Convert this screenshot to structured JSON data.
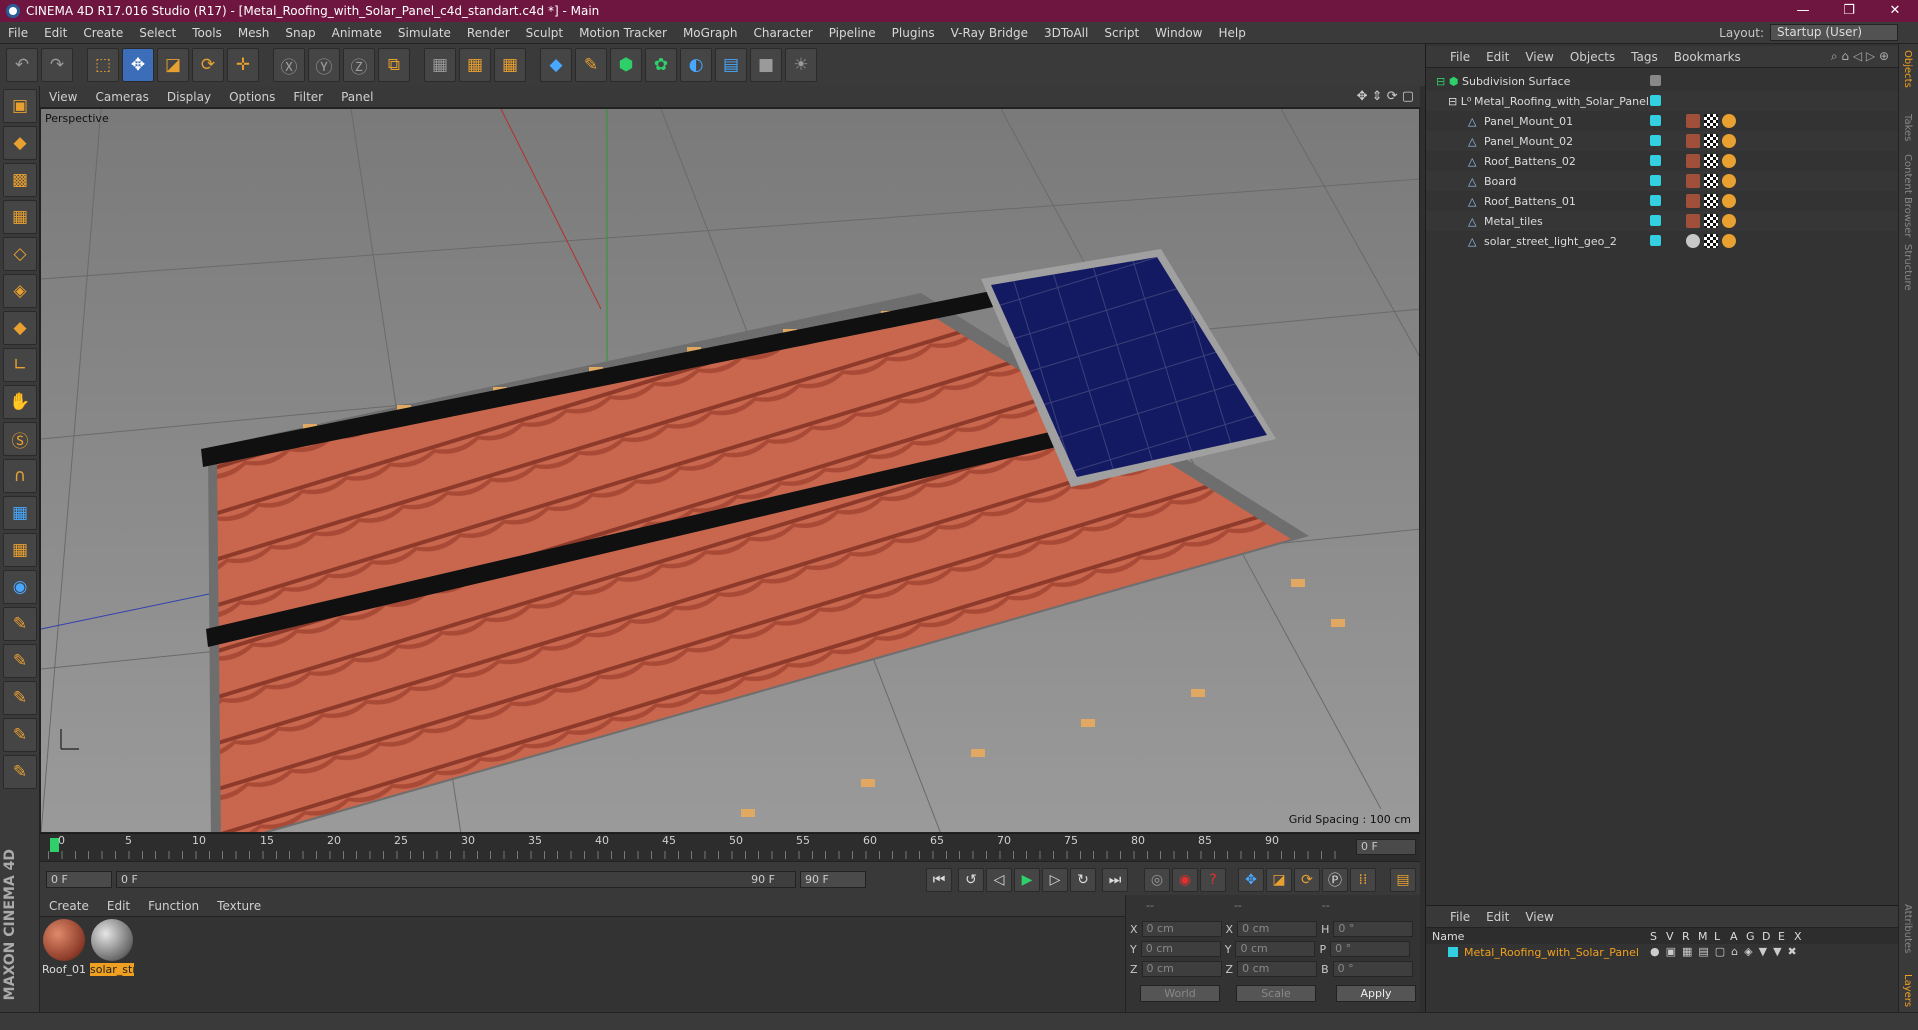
{
  "app": {
    "title": "CINEMA 4D R17.016 Studio (R17) - [Metal_Roofing_with_Solar_Panel_c4d_standart.c4d *] - Main",
    "window_buttons": [
      "—",
      "❐",
      "✕"
    ]
  },
  "menu": [
    "File",
    "Edit",
    "Create",
    "Select",
    "Tools",
    "Mesh",
    "Snap",
    "Animate",
    "Simulate",
    "Render",
    "Sculpt",
    "Motion Tracker",
    "MoGraph",
    "Character",
    "Pipeline",
    "Plugins",
    "V-Ray Bridge",
    "3DToAll",
    "Script",
    "Window",
    "Help"
  ],
  "layout": {
    "label": "Layout:",
    "value": "Startup (User)"
  },
  "viewport": {
    "menu": [
      "View",
      "Cameras",
      "Display",
      "Options",
      "Filter",
      "Panel"
    ],
    "label": "Perspective",
    "grid_spacing": "Grid Spacing : 100 cm"
  },
  "timeline": {
    "ticks": [
      "0",
      "5",
      "10",
      "15",
      "20",
      "25",
      "30",
      "35",
      "40",
      "45",
      "50",
      "55",
      "60",
      "65",
      "70",
      "75",
      "80",
      "85",
      "90"
    ],
    "current_frame": "0 F"
  },
  "transport": {
    "start": "0 F",
    "range_start": "0 F",
    "range_end": "90 F",
    "end": "90 F"
  },
  "materials": {
    "menu": [
      "Create",
      "Edit",
      "Function",
      "Texture"
    ],
    "items": [
      {
        "name": "Roof_01",
        "selected": false
      },
      {
        "name": "solar_str",
        "selected": true
      }
    ]
  },
  "coordinates": {
    "headers": [
      "--",
      "--",
      "--"
    ],
    "rows": [
      {
        "a": "X",
        "av": "0 cm",
        "b": "X",
        "bv": "0 cm",
        "c": "H",
        "cv": "0 °"
      },
      {
        "a": "Y",
        "av": "0 cm",
        "b": "Y",
        "bv": "0 cm",
        "c": "P",
        "cv": "0 °"
      },
      {
        "a": "Z",
        "av": "0 cm",
        "b": "Z",
        "bv": "0 cm",
        "c": "B",
        "cv": "0 °"
      }
    ],
    "mode": "World",
    "scale": "Scale",
    "apply": "Apply"
  },
  "objects": {
    "menu": [
      "File",
      "Edit",
      "View",
      "Objects",
      "Tags",
      "Bookmarks"
    ],
    "items": [
      {
        "name": "Subdivision Surface",
        "level": 0
      },
      {
        "name": "Metal_Roofing_with_Solar_Panel",
        "level": 1
      },
      {
        "name": "Panel_Mount_01",
        "level": 2
      },
      {
        "name": "Panel_Mount_02",
        "level": 2
      },
      {
        "name": "Roof_Battens_02",
        "level": 2
      },
      {
        "name": "Board",
        "level": 2
      },
      {
        "name": "Roof_Battens_01",
        "level": 2
      },
      {
        "name": "Metal_tiles",
        "level": 2
      },
      {
        "name": "solar_street_light_geo_2",
        "level": 2
      }
    ]
  },
  "layers": {
    "menu": [
      "File",
      "Edit",
      "View"
    ],
    "header": {
      "name": "Name",
      "cols": [
        "S",
        "V",
        "R",
        "M",
        "L",
        "A",
        "G",
        "D",
        "E",
        "X"
      ]
    },
    "row": "Metal_Roofing_with_Solar_Panel"
  },
  "side_tabs": [
    "Objects",
    "Takes",
    "Content Browser",
    "Structure",
    "Attributes",
    "Layers"
  ],
  "brand": "MAXON CINEMA 4D",
  "colors": {
    "title_bar": "#6f1640",
    "accent": "#f0a020",
    "tile": "#c8674e",
    "panel": "#151a5a"
  }
}
